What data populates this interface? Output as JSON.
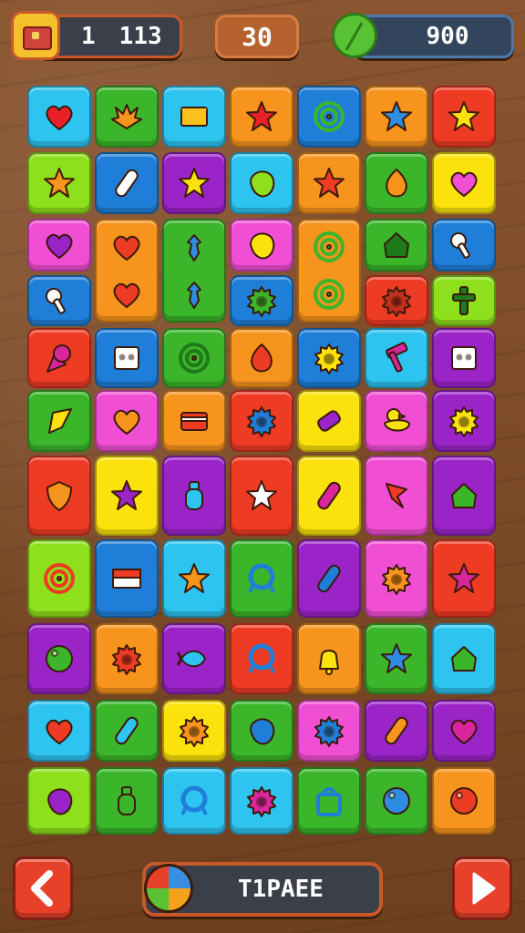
{
  "hud": {
    "lives_label": "1",
    "lives_value": "113",
    "moves": "30",
    "score": "900"
  },
  "bottom": {
    "label": "T1PAEE"
  },
  "palette": {
    "cyan": "#2ec4f0",
    "green": "#3bb52a",
    "lime": "#8ee01c",
    "orange": "#f7941d",
    "red": "#ee3b24",
    "yellow": "#fbe20c",
    "pink": "#f14fd3",
    "purple": "#9b24c9",
    "blue": "#1f7fd8"
  },
  "board": {
    "rows": 10,
    "cols": 7,
    "tiles": [
      {
        "r": 0,
        "c": 0,
        "h": 1,
        "color": "cyan",
        "icon": "heart",
        "fg": "#e8202a"
      },
      {
        "r": 0,
        "c": 1,
        "h": 1,
        "color": "green",
        "icon": "flower",
        "fg": "#f7941d"
      },
      {
        "r": 0,
        "c": 2,
        "h": 1,
        "color": "cyan",
        "icon": "envelope",
        "fg": "#fbc21e"
      },
      {
        "r": 0,
        "c": 3,
        "h": 1,
        "color": "orange",
        "icon": "star",
        "fg": "#e8202a"
      },
      {
        "r": 0,
        "c": 4,
        "h": 1,
        "color": "blue",
        "icon": "spiral",
        "fg": "#3bb52a"
      },
      {
        "r": 0,
        "c": 5,
        "h": 1,
        "color": "orange",
        "icon": "star",
        "fg": "#2e8de0"
      },
      {
        "r": 0,
        "c": 6,
        "h": 1,
        "color": "red",
        "icon": "star",
        "fg": "#fbe20c"
      },
      {
        "r": 1,
        "c": 0,
        "h": 1,
        "color": "lime",
        "icon": "star",
        "fg": "#f7941d"
      },
      {
        "r": 1,
        "c": 1,
        "h": 1,
        "color": "blue",
        "icon": "capsule",
        "fg": "#ffffff"
      },
      {
        "r": 1,
        "c": 2,
        "h": 1,
        "color": "purple",
        "icon": "star",
        "fg": "#fbe20c"
      },
      {
        "r": 1,
        "c": 3,
        "h": 1,
        "color": "cyan",
        "icon": "blob",
        "fg": "#8ee01c"
      },
      {
        "r": 1,
        "c": 4,
        "h": 1,
        "color": "orange",
        "icon": "star",
        "fg": "#ee3b24"
      },
      {
        "r": 1,
        "c": 5,
        "h": 1,
        "color": "green",
        "icon": "drop",
        "fg": "#f7941d"
      },
      {
        "r": 1,
        "c": 6,
        "h": 1,
        "color": "yellow",
        "icon": "heart",
        "fg": "#f14fd3"
      },
      {
        "r": 2,
        "c": 0,
        "h": 1,
        "color": "pink",
        "icon": "heart",
        "fg": "#9b24c9"
      },
      {
        "r": 2,
        "c": 1,
        "h": 2,
        "color": "orange",
        "icon": "heart",
        "fg": "#ee3b24"
      },
      {
        "r": 2,
        "c": 2,
        "h": 2,
        "color": "green",
        "icon": "sprout",
        "fg": "#2e8de0"
      },
      {
        "r": 2,
        "c": 3,
        "h": 1,
        "color": "pink",
        "icon": "blob",
        "fg": "#fbe20c"
      },
      {
        "r": 2,
        "c": 4,
        "h": 2,
        "color": "orange",
        "icon": "spiral",
        "fg": "#3bb52a"
      },
      {
        "r": 2,
        "c": 5,
        "h": 1,
        "color": "green",
        "icon": "house",
        "fg": "#1f7a1a"
      },
      {
        "r": 2,
        "c": 6,
        "h": 1,
        "color": "blue",
        "icon": "key",
        "fg": "#ffffff"
      },
      {
        "r": 3,
        "c": 0,
        "h": 1,
        "color": "blue",
        "icon": "key",
        "fg": "#ffffff"
      },
      {
        "r": 3,
        "c": 3,
        "h": 1,
        "color": "blue",
        "icon": "gear",
        "fg": "#3bb52a"
      },
      {
        "r": 3,
        "c": 5,
        "h": 1,
        "color": "red",
        "icon": "gear",
        "fg": "#c0301c"
      },
      {
        "r": 3,
        "c": 6,
        "h": 1,
        "color": "lime",
        "icon": "cross",
        "fg": "#1f7a1a"
      },
      {
        "r": 4,
        "c": 0,
        "h": 1,
        "color": "red",
        "icon": "cone",
        "fg": "#d9269c"
      },
      {
        "r": 4,
        "c": 1,
        "h": 1,
        "color": "blue",
        "icon": "box",
        "fg": "#ffffff"
      },
      {
        "r": 4,
        "c": 2,
        "h": 1,
        "color": "green",
        "icon": "spiral",
        "fg": "#1f7a1a"
      },
      {
        "r": 4,
        "c": 3,
        "h": 1,
        "color": "orange",
        "icon": "drop",
        "fg": "#ee3b24"
      },
      {
        "r": 4,
        "c": 4,
        "h": 1,
        "color": "blue",
        "icon": "gear",
        "fg": "#fbe20c"
      },
      {
        "r": 4,
        "c": 5,
        "h": 1,
        "color": "cyan",
        "icon": "hammer",
        "fg": "#d9269c"
      },
      {
        "r": 4,
        "c": 6,
        "h": 1,
        "color": "purple",
        "icon": "box",
        "fg": "#ffffff"
      },
      {
        "r": 5,
        "c": 0,
        "h": 1,
        "color": "green",
        "icon": "kite",
        "fg": "#fbe20c"
      },
      {
        "r": 5,
        "c": 1,
        "h": 1,
        "color": "pink",
        "icon": "heart",
        "fg": "#f7941d"
      },
      {
        "r": 5,
        "c": 2,
        "h": 1,
        "color": "orange",
        "icon": "card",
        "fg": "#ee3b24"
      },
      {
        "r": 5,
        "c": 3,
        "h": 1,
        "color": "red",
        "icon": "gear",
        "fg": "#1f7fd8"
      },
      {
        "r": 5,
        "c": 4,
        "h": 1,
        "color": "yellow",
        "icon": "candy",
        "fg": "#9b24c9"
      },
      {
        "r": 5,
        "c": 5,
        "h": 1,
        "color": "pink",
        "icon": "duck",
        "fg": "#fbe20c"
      },
      {
        "r": 5,
        "c": 6,
        "h": 1,
        "color": "purple",
        "icon": "gear",
        "fg": "#fbe20c"
      },
      {
        "r": 6,
        "c": 0,
        "h": 1.3,
        "color": "red",
        "icon": "shield",
        "fg": "#f7941d"
      },
      {
        "r": 6,
        "c": 1,
        "h": 1.3,
        "color": "yellow",
        "icon": "star",
        "fg": "#9b24c9"
      },
      {
        "r": 6,
        "c": 2,
        "h": 1.3,
        "color": "purple",
        "icon": "bottle",
        "fg": "#2ec4f0"
      },
      {
        "r": 6,
        "c": 3,
        "h": 1.3,
        "color": "red",
        "icon": "star",
        "fg": "#ffffff"
      },
      {
        "r": 6,
        "c": 4,
        "h": 1.3,
        "color": "yellow",
        "icon": "capsule",
        "fg": "#d9269c"
      },
      {
        "r": 6,
        "c": 5,
        "h": 1.3,
        "color": "pink",
        "icon": "flag",
        "fg": "#ee3b24"
      },
      {
        "r": 6,
        "c": 6,
        "h": 1.3,
        "color": "purple",
        "icon": "house",
        "fg": "#3bb52a"
      },
      {
        "r": 7,
        "c": 0,
        "h": 1.2,
        "color": "lime",
        "icon": "spiral",
        "fg": "#ee3b24"
      },
      {
        "r": 7,
        "c": 1,
        "h": 1.2,
        "color": "blue",
        "icon": "flag-rect",
        "fg": "#ffffff"
      },
      {
        "r": 7,
        "c": 2,
        "h": 1.2,
        "color": "cyan",
        "icon": "star",
        "fg": "#f7941d"
      },
      {
        "r": 7,
        "c": 3,
        "h": 1.2,
        "color": "green",
        "icon": "ring",
        "fg": "#1f7fd8"
      },
      {
        "r": 7,
        "c": 4,
        "h": 1.2,
        "color": "purple",
        "icon": "capsule",
        "fg": "#1f7fd8"
      },
      {
        "r": 7,
        "c": 5,
        "h": 1.2,
        "color": "pink",
        "icon": "gear",
        "fg": "#f7941d"
      },
      {
        "r": 7,
        "c": 6,
        "h": 1.2,
        "color": "red",
        "icon": "star",
        "fg": "#d9269c"
      },
      {
        "r": 8,
        "c": 0,
        "h": 1.2,
        "color": "purple",
        "icon": "ball",
        "fg": "#3bb52a"
      },
      {
        "r": 8,
        "c": 1,
        "h": 1.2,
        "color": "orange",
        "icon": "gear",
        "fg": "#ee3b24"
      },
      {
        "r": 8,
        "c": 2,
        "h": 1.2,
        "color": "purple",
        "icon": "fish",
        "fg": "#2ec4f0"
      },
      {
        "r": 8,
        "c": 3,
        "h": 1.2,
        "color": "red",
        "icon": "ring",
        "fg": "#1f7fd8"
      },
      {
        "r": 8,
        "c": 4,
        "h": 1.2,
        "color": "orange",
        "icon": "bell",
        "fg": "#fbe20c"
      },
      {
        "r": 8,
        "c": 5,
        "h": 1.2,
        "color": "green",
        "icon": "star",
        "fg": "#2e8de0"
      },
      {
        "r": 8,
        "c": 6,
        "h": 1.2,
        "color": "cyan",
        "icon": "house",
        "fg": "#3bb52a"
      },
      {
        "r": 9,
        "c": 0,
        "h": 1,
        "color": "cyan",
        "icon": "heart",
        "fg": "#ee3b24"
      },
      {
        "r": 9,
        "c": 1,
        "h": 1,
        "color": "green",
        "icon": "capsule",
        "fg": "#2ec4f0"
      },
      {
        "r": 9,
        "c": 2,
        "h": 1,
        "color": "yellow",
        "icon": "gear",
        "fg": "#f7941d"
      },
      {
        "r": 9,
        "c": 3,
        "h": 1,
        "color": "green",
        "icon": "blob",
        "fg": "#1f7fd8"
      },
      {
        "r": 9,
        "c": 4,
        "h": 1,
        "color": "pink",
        "icon": "gear",
        "fg": "#1f7fd8"
      },
      {
        "r": 9,
        "c": 5,
        "h": 1,
        "color": "purple",
        "icon": "capsule",
        "fg": "#f7941d"
      },
      {
        "r": 9,
        "c": 6,
        "h": 1,
        "color": "purple",
        "icon": "heart",
        "fg": "#d9269c"
      },
      {
        "r": 10,
        "c": 0,
        "h": 1,
        "color": "lime",
        "icon": "blob",
        "fg": "#9b24c9"
      },
      {
        "r": 10,
        "c": 1,
        "h": 1,
        "color": "green",
        "icon": "bottle",
        "fg": "#3bb52a"
      },
      {
        "r": 10,
        "c": 2,
        "h": 1,
        "color": "cyan",
        "icon": "ring",
        "fg": "#1f7fd8"
      },
      {
        "r": 10,
        "c": 3,
        "h": 1,
        "color": "cyan",
        "icon": "gear",
        "fg": "#d9269c"
      },
      {
        "r": 10,
        "c": 4,
        "h": 1,
        "color": "green",
        "icon": "bag",
        "fg": "#1f7fd8"
      },
      {
        "r": 10,
        "c": 5,
        "h": 1,
        "color": "green",
        "icon": "ball",
        "fg": "#2e8de0"
      },
      {
        "r": 10,
        "c": 6,
        "h": 1,
        "color": "orange",
        "icon": "ball",
        "fg": "#ee3b24"
      }
    ]
  }
}
